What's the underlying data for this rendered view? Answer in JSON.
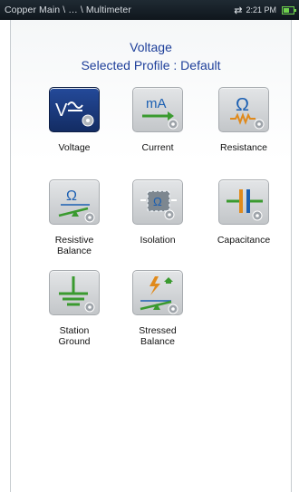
{
  "statusbar": {
    "breadcrumb": "Copper Main \\ … \\ Multimeter",
    "time": "2:21 PM",
    "sync_icon": "sync-arrows-icon",
    "battery_icon": "battery-charging-icon"
  },
  "header": {
    "title": "Voltage",
    "subtitle": "Selected Profile : Default"
  },
  "tiles": [
    {
      "label": "Voltage",
      "icon": "voltage-icon",
      "selected": true
    },
    {
      "label": "Current",
      "icon": "current-icon",
      "selected": false
    },
    {
      "label": "Resistance",
      "icon": "resistance-icon",
      "selected": false
    },
    {
      "label": "Resistive\nBalance",
      "icon": "resistive-balance-icon",
      "selected": false
    },
    {
      "label": "Isolation",
      "icon": "isolation-icon",
      "selected": false
    },
    {
      "label": "Capacitance",
      "icon": "capacitance-icon",
      "selected": false
    },
    {
      "label": "Station\nGround",
      "icon": "station-ground-icon",
      "selected": false
    },
    {
      "label": "Stressed\nBalance",
      "icon": "stressed-balance-icon",
      "selected": false
    }
  ],
  "colors": {
    "accent": "#1e3f9a",
    "selected_tile": "#1c3b80",
    "icon_blue": "#1b5fb2",
    "icon_green": "#3a9a2f",
    "icon_orange": "#e08a1c"
  }
}
